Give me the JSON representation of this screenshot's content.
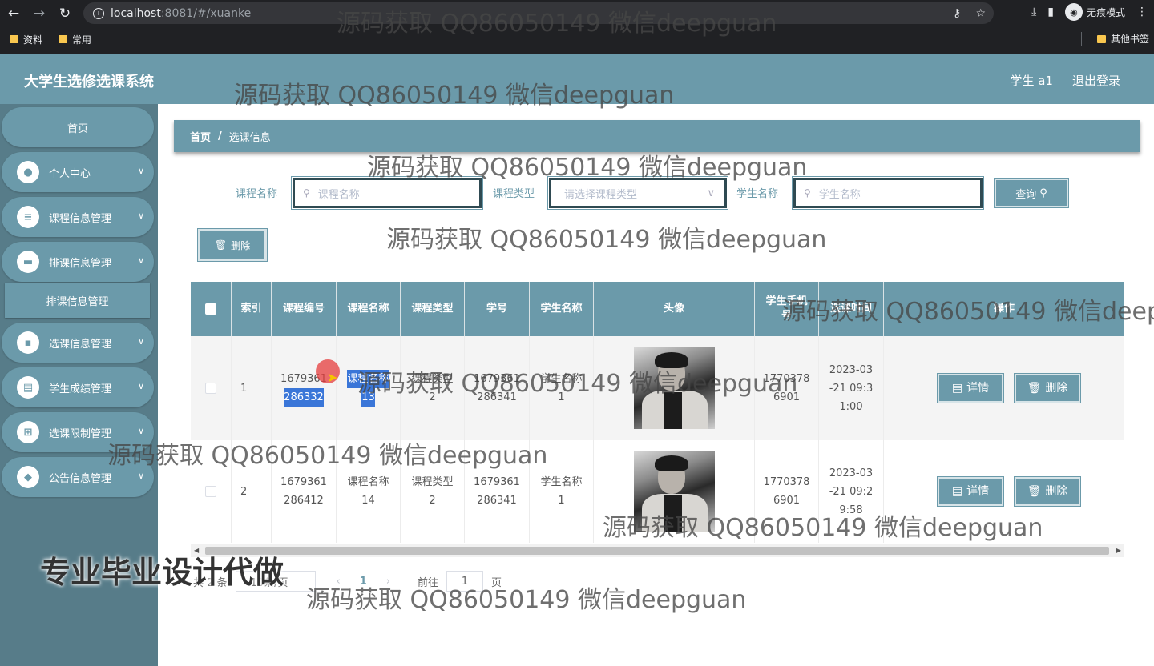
{
  "browser": {
    "url_host": "localhost",
    "url_rest": ":8081/#/xuanke",
    "incognito_label": "无痕模式",
    "bookmarks": [
      "资料",
      "常用"
    ],
    "other_bookmarks": "其他书签"
  },
  "header": {
    "title": "大学生选修选课系统",
    "user": "学生 a1",
    "logout": "退出登录"
  },
  "sidebar": {
    "items": [
      {
        "label": "首页",
        "icon": "home"
      },
      {
        "label": "个人中心",
        "icon": "user-icon"
      },
      {
        "label": "课程信息管理",
        "icon": "list-icon"
      },
      {
        "label": "排课信息管理",
        "icon": "briefcase-icon"
      },
      {
        "label": "选课信息管理",
        "icon": "chat-icon"
      },
      {
        "label": "学生成绩管理",
        "icon": "clipboard-icon"
      },
      {
        "label": "选课限制管理",
        "icon": "grid-icon"
      },
      {
        "label": "公告信息管理",
        "icon": "ticket-icon"
      }
    ],
    "submenu_label": "排课信息管理"
  },
  "breadcrumb": {
    "home": "首页",
    "sep": "/",
    "current": "选课信息"
  },
  "filters": {
    "course_name_label": "课程名称",
    "course_name_placeholder": "课程名称",
    "course_type_label": "课程类型",
    "course_type_placeholder": "请选择课程类型",
    "student_name_label": "学生名称",
    "student_name_placeholder": "学生名称",
    "query_label": "查询"
  },
  "toolbar": {
    "delete_label": "删除"
  },
  "table": {
    "headers": [
      "索引",
      "课程编号",
      "课程名称",
      "课程类型",
      "学号",
      "学生名称",
      "头像",
      "学生手机号",
      "选课时间",
      "操作"
    ],
    "rows": [
      {
        "index": "1",
        "course_no_a": "1679361",
        "course_no_b": "286332",
        "course_name_a": "课程名称",
        "course_name_b": "13",
        "course_type_a": "课程类型",
        "course_type_b": "2",
        "student_no_a": "1679361",
        "student_no_b": "286341",
        "student_name_a": "学生名称",
        "student_name_b": "1",
        "phone_a": "1770378",
        "phone_b": "6901",
        "time_a": "2023-03",
        "time_b": "-21 09:3",
        "time_c": "1:00"
      },
      {
        "index": "2",
        "course_no_a": "1679361",
        "course_no_b": "286412",
        "course_name_a": "课程名称",
        "course_name_b": "14",
        "course_type_a": "课程类型",
        "course_type_b": "2",
        "student_no_a": "1679361",
        "student_no_b": "286341",
        "student_name_a": "学生名称",
        "student_name_b": "1",
        "phone_a": "1770378",
        "phone_b": "6901",
        "time_a": "2023-03",
        "time_b": "-21 09:2",
        "time_c": "9:58"
      }
    ],
    "detail_label": "详情",
    "delete_label": "删除"
  },
  "pagination": {
    "total": "共 2 条",
    "page_size": "10条/页",
    "current_page": "1",
    "goto_label": "前往",
    "goto_value": "1",
    "page_unit": "页"
  },
  "watermarks": {
    "text": "源码获取 QQ86050149 微信deepguan",
    "big": "专业毕业设计代做"
  },
  "colors": {
    "accent": "#6b9aaa",
    "sidebar": "#577c89"
  }
}
